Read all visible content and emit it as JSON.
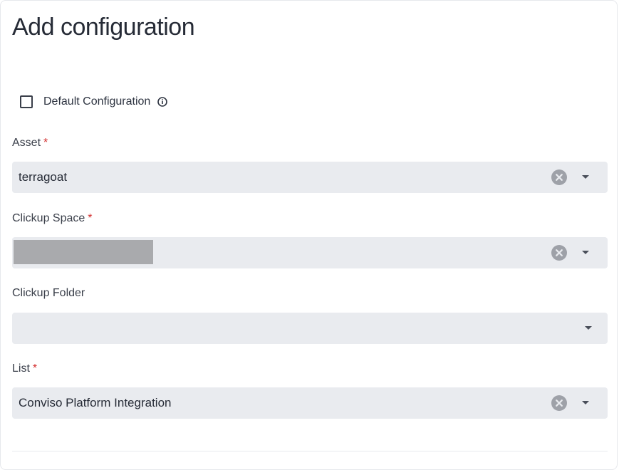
{
  "dialog": {
    "title": "Add configuration"
  },
  "default_configuration": {
    "label": "Default Configuration",
    "checked": false,
    "info_icon": "info-circle-icon"
  },
  "fields": {
    "asset": {
      "label": "Asset",
      "required_marker": "*",
      "value": "terragoat"
    },
    "clickup_space": {
      "label": "Clickup Space",
      "required_marker": "*",
      "value": ""
    },
    "clickup_folder": {
      "label": "Clickup Folder",
      "value": ""
    },
    "list": {
      "label": "List",
      "required_marker": "*",
      "value": "Conviso Platform Integration"
    }
  },
  "icons": {
    "clear": "clear-circle-icon",
    "dropdown": "chevron-down-icon"
  },
  "colors": {
    "required": "#d32f2f",
    "field_bg": "#e9ebef",
    "clear_icon": "#9ea1a8"
  }
}
